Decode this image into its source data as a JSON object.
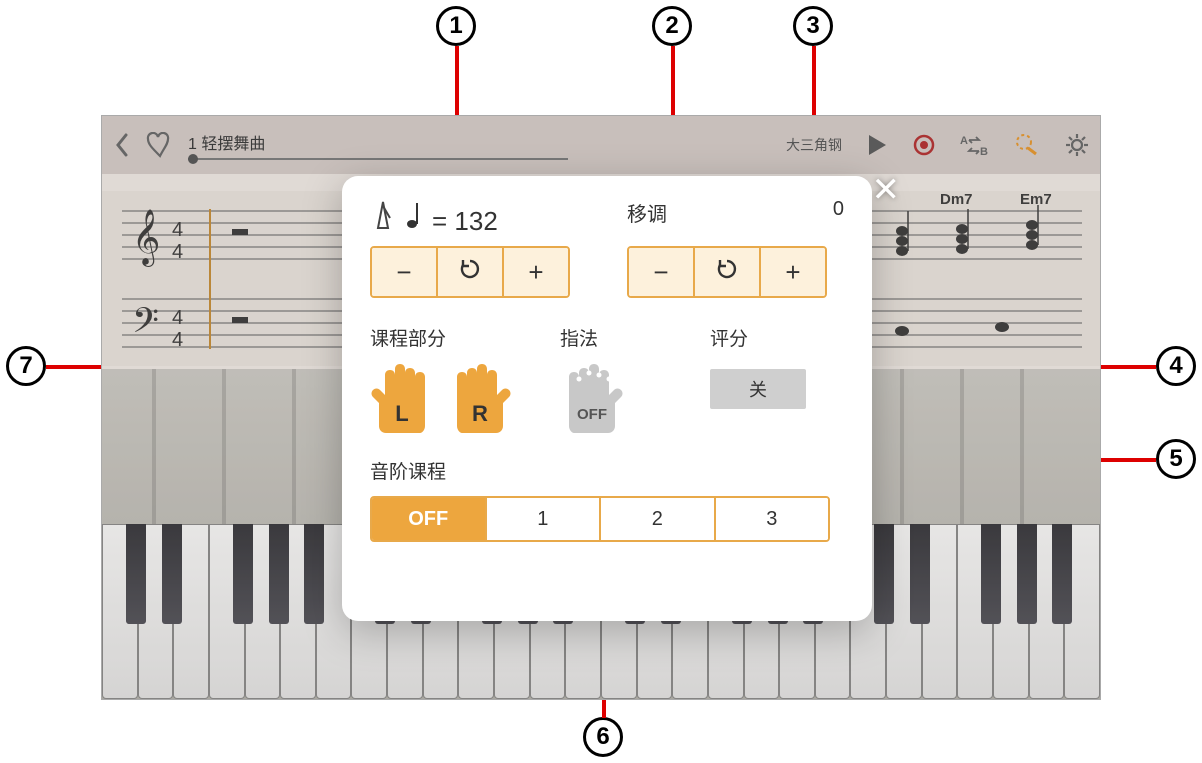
{
  "callouts": [
    "1",
    "2",
    "3",
    "4",
    "5",
    "6",
    "7"
  ],
  "topbar": {
    "song_title": "1 轻摆舞曲",
    "instrument": "大三角钢"
  },
  "chords": {
    "dm7": "Dm7",
    "em7": "Em7"
  },
  "popup": {
    "tempo": {
      "value": "132",
      "prefix": " = "
    },
    "transpose": {
      "label": "移调",
      "value": "0"
    },
    "stepper": {
      "minus": "−",
      "reset": "↻",
      "plus": "+"
    },
    "lesson_part": {
      "label": "课程部分",
      "left": "L",
      "right": "R"
    },
    "fingering": {
      "label": "指法",
      "state": "OFF"
    },
    "scoring": {
      "label": "评分",
      "button": "关"
    },
    "step_lesson": {
      "label": "音阶课程",
      "options": [
        "OFF",
        "1",
        "2",
        "3"
      ],
      "active_index": 0
    }
  }
}
